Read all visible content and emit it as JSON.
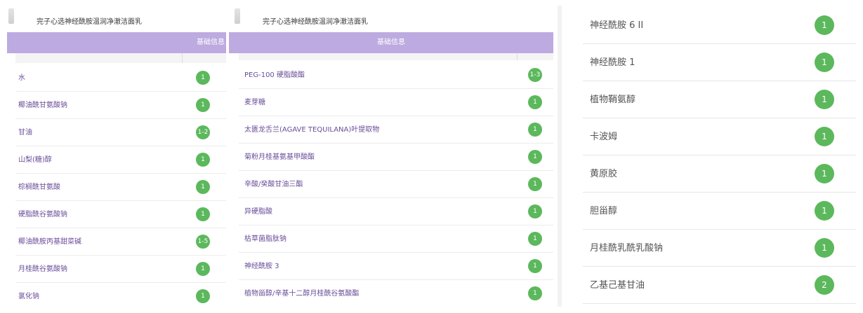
{
  "panels": [
    {
      "title": "完子心选神经酰胺温润净澈洁面乳",
      "band_label": "基础信息",
      "rows": [
        {
          "name": "水",
          "score": "1"
        },
        {
          "name": "椰油酰甘氨酸钠",
          "score": "1"
        },
        {
          "name": "甘油",
          "score": "1-2"
        },
        {
          "name": "山梨(糖)醇",
          "score": "1"
        },
        {
          "name": "棕榈酰甘氨酸",
          "score": "1"
        },
        {
          "name": "硬脂酰谷氨酸钠",
          "score": "1"
        },
        {
          "name": "椰油酰胺丙基甜菜碱",
          "score": "1-5"
        },
        {
          "name": "月桂酰谷氨酸钠",
          "score": "1"
        },
        {
          "name": "氯化钠",
          "score": "1"
        }
      ]
    },
    {
      "title": "完子心选神经酰胺温润净澈洁面乳",
      "band_label": "基础信息",
      "rows": [
        {
          "name": "PEG-100 硬脂酸酯",
          "score": "1-3"
        },
        {
          "name": "麦芽糖",
          "score": "1"
        },
        {
          "name": "太匮龙舌兰(AGAVE TEQUILANA)叶提取物",
          "score": "1"
        },
        {
          "name": "菊粉月桂基氨基甲酸酯",
          "score": "1"
        },
        {
          "name": "辛酸/癸酸甘油三酯",
          "score": "1"
        },
        {
          "name": "异硬脂酸",
          "score": "1"
        },
        {
          "name": "枯草菌脂肽钠",
          "score": "1"
        },
        {
          "name": "神经酰胺 3",
          "score": "1"
        },
        {
          "name": "植物甾醇/辛基十二醇月桂酰谷氨酸酯",
          "score": "1"
        }
      ]
    },
    {
      "rows": [
        {
          "name": "神经酰胺 6 II",
          "score": "1"
        },
        {
          "name": "神经酰胺 1",
          "score": "1"
        },
        {
          "name": "植物鞘氨醇",
          "score": "1"
        },
        {
          "name": "卡波姆",
          "score": "1"
        },
        {
          "name": "黄原胶",
          "score": "1"
        },
        {
          "name": "胆甾醇",
          "score": "1"
        },
        {
          "name": "月桂酰乳酰乳酸钠",
          "score": "1"
        },
        {
          "name": "乙基己基甘油",
          "score": "2"
        }
      ]
    }
  ],
  "colors": {
    "band": "#bcaae0",
    "badge": "#5cb85c",
    "ingredient_text": "#6a4e9a"
  }
}
